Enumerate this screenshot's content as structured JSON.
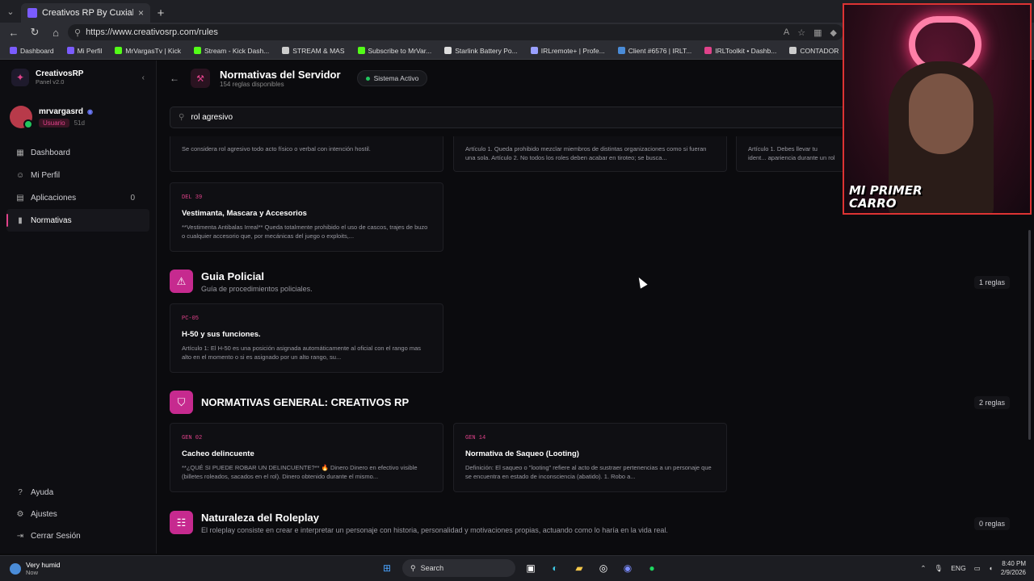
{
  "browser": {
    "tab_title": "Creativos RP By Cuxial",
    "url": "https://www.creativosrp.com/rules",
    "bookmarks": [
      {
        "label": "Dashboard",
        "color": "#7b5cff"
      },
      {
        "label": "Mi Perfil",
        "color": "#7b5cff"
      },
      {
        "label": "MrVargasTv | Kick",
        "color": "#53fc18"
      },
      {
        "label": "Stream - Kick Dash...",
        "color": "#53fc18"
      },
      {
        "label": "STREAM & MAS",
        "color": "#cccccc"
      },
      {
        "label": "Subscribe to MrVar...",
        "color": "#53fc18"
      },
      {
        "label": "Starlink Battery Po...",
        "color": "#dddddd"
      },
      {
        "label": "IRLremote+ | Profe...",
        "color": "#9aa0ff"
      },
      {
        "label": "Client #6576 | IRLT...",
        "color": "#4a8cd8"
      },
      {
        "label": "IRLToolkit • Dashb...",
        "color": "#e0428a"
      },
      {
        "label": "CONTADOR",
        "color": "#cccccc"
      }
    ]
  },
  "sidebar": {
    "brand_name": "CreativosRP",
    "brand_sub": "Panel v2.0",
    "user_name": "mrvargasrd",
    "user_role": "Usuario",
    "user_days": "51d",
    "items": [
      {
        "label": "Dashboard",
        "icon": "grid-icon"
      },
      {
        "label": "Mi Perfil",
        "icon": "user-icon"
      },
      {
        "label": "Aplicaciones",
        "icon": "file-icon",
        "count": "0"
      },
      {
        "label": "Normativas",
        "icon": "book-icon"
      }
    ],
    "bottom": [
      {
        "label": "Ayuda",
        "icon": "help-icon"
      },
      {
        "label": "Ajustes",
        "icon": "gear-icon"
      },
      {
        "label": "Cerrar Sesión",
        "icon": "logout-icon"
      }
    ]
  },
  "header": {
    "title": "Normativas del Servidor",
    "subtitle": "154 reglas disponibles",
    "status": "Sistema Activo"
  },
  "search": {
    "value": "rol agresivo"
  },
  "top_cards": [
    {
      "desc": "Se considera rol agresivo todo acto físico o verbal con intención hostil."
    },
    {
      "desc": "Artículo 1. Queda prohibido mezclar miembros de distintas organizaciones como si fueran una sola. Artículo 2. No todos los roles deben acabar en tiroteo; se busca..."
    },
    {
      "desc": "Artículo 1. Debes llevar tu ident... apariencia durante un rol agres..."
    }
  ],
  "card_del39": {
    "code": "DEL 39",
    "title": "Vestimanta, Mascara y Accesorios",
    "desc": "**Vestimenta Antibalas Irreal** Queda totalmente prohibido el uso de cascos, trajes de buzo o cualquier accesorio que, por mecánicas del juego o exploits,..."
  },
  "sections": [
    {
      "title": "Guia Policial",
      "desc": "Guía de procedimientos policiales.",
      "count": "1 reglas",
      "icon": "siren-icon",
      "cards": [
        {
          "code": "PC-05",
          "title": "H-50 y sus funciones.",
          "desc": "Artículo 1: El H-50 es una posición asignada automáticamente al oficial con el rango mas alto en el momento o si es asignado por un alto rango, su..."
        }
      ]
    },
    {
      "title": "NORMATIVAS GENERAL: CREATIVOS RP",
      "desc": "",
      "count": "2 reglas",
      "icon": "shield-icon",
      "cards": [
        {
          "code": "GEN 02",
          "title": "Cacheo delincuente",
          "desc": "**¿QUÉ SI PUEDE ROBAR UN DELINCUENTE?** 🔥 Dinero Dinero en efectivo visible (billetes roleados, sacados en el rol). Dinero obtenido durante el mismo..."
        },
        {
          "code": "GEN 14",
          "title": "Normativa de Saqueo (Looting)",
          "desc": "Definición: El saqueo o \"looting\" refiere al acto de sustraer pertenencias a un personaje que se encuentra en estado de inconsciencia (abatido). 1. Robo a..."
        }
      ]
    },
    {
      "title": "Naturaleza del Roleplay",
      "desc": "El roleplay consiste en crear e interpretar un personaje con historia, personalidad y motivaciones propias, actuando como lo haría en la vida real.",
      "count": "0 reglas",
      "icon": "users-icon",
      "cards": []
    }
  ],
  "webcam": {
    "caption": "MI PRIMER CARRO"
  },
  "taskbar": {
    "weather_title": "Very humid",
    "weather_sub": "Now",
    "search_label": "Search",
    "lang": "ENG",
    "time": "8:40 PM",
    "date": "2/9/2026"
  },
  "colors": {
    "accent": "#e0428a",
    "section_icon": "#c62a8f",
    "status": "#22c55e"
  }
}
